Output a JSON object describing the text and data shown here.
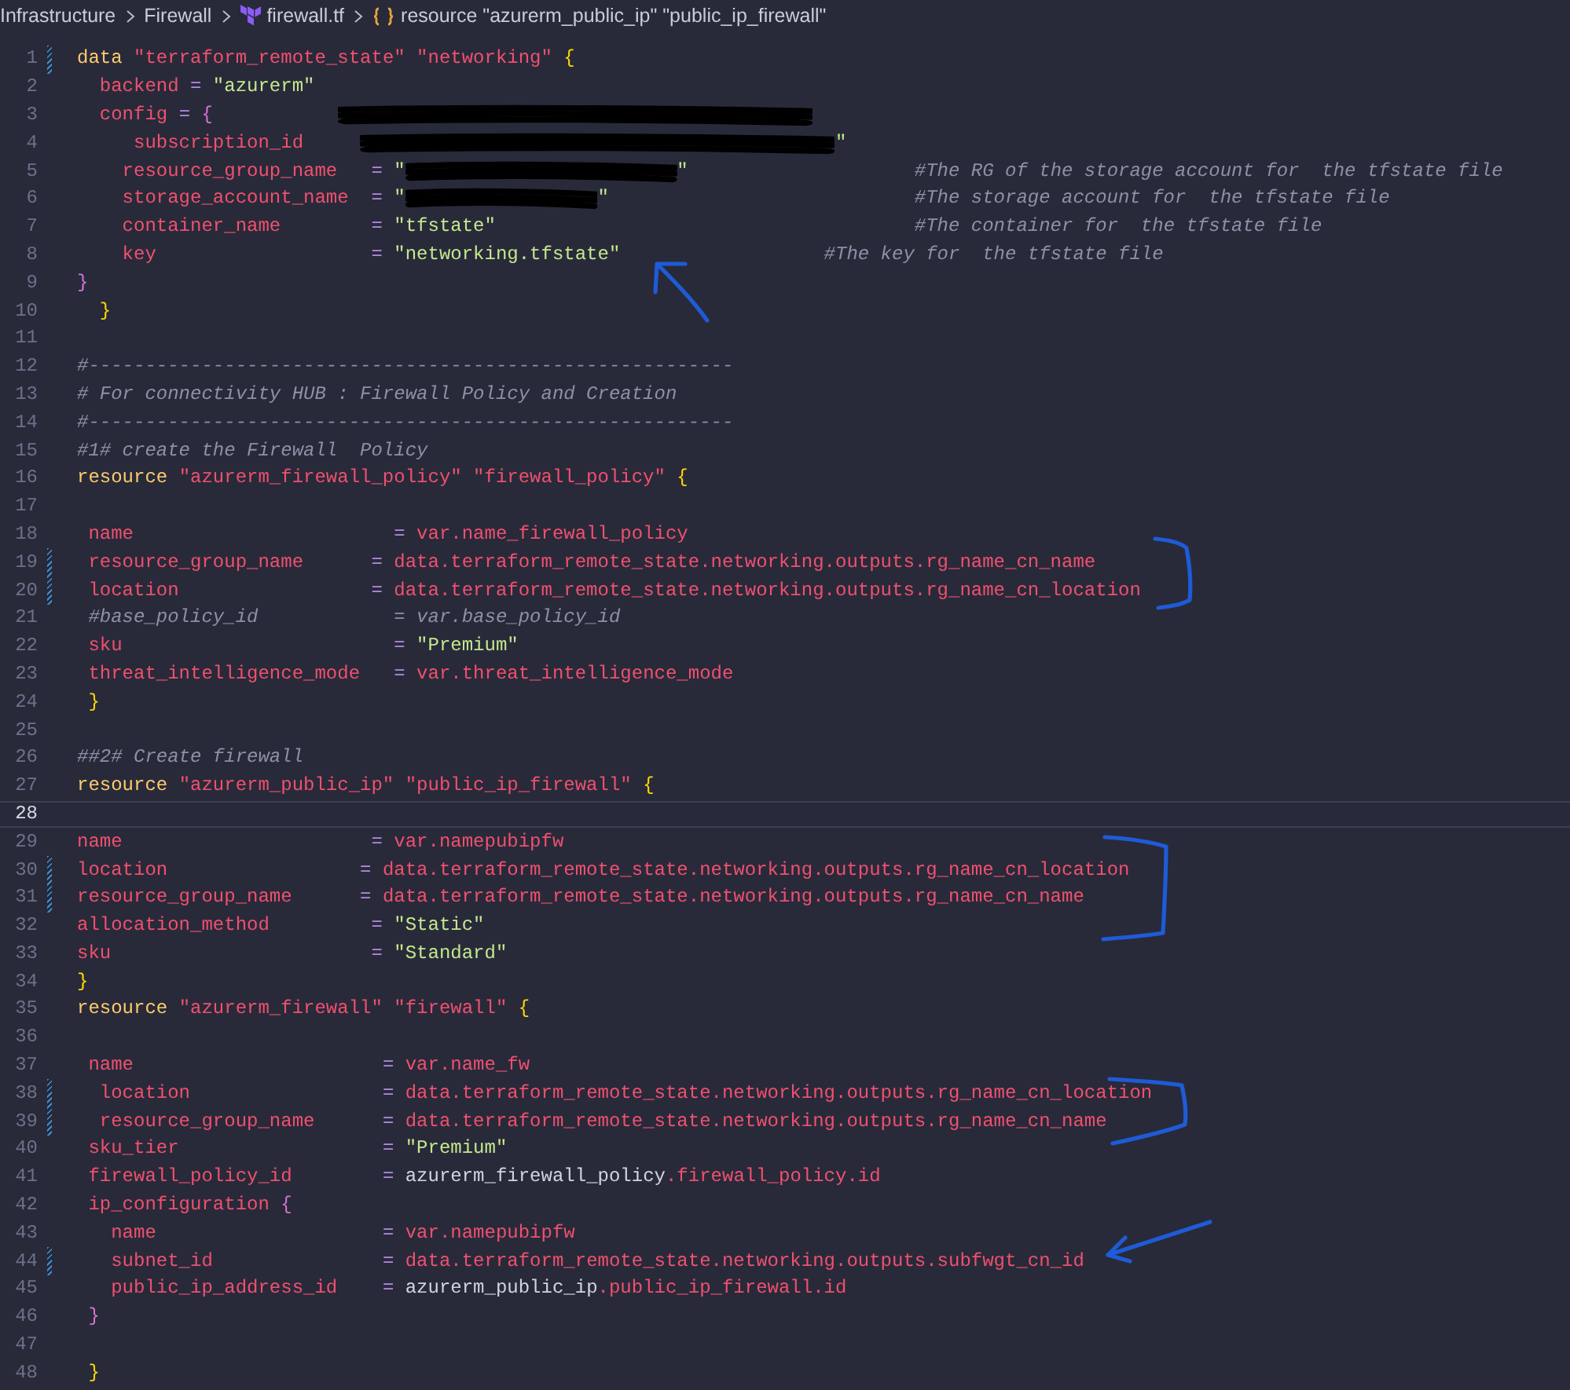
{
  "breadcrumb": [
    {
      "kind": "folder",
      "label": "Infrastructure"
    },
    {
      "kind": "folder",
      "label": "Firewall"
    },
    {
      "kind": "file",
      "label": "firewall.tf"
    },
    {
      "kind": "symbol",
      "label": "resource \"azurerm_public_ip\" \"public_ip_firewall\""
    }
  ],
  "lines": [
    {
      "number": "1",
      "modified": true,
      "current": false,
      "tokens": [
        {
          "kind": "keyword",
          "text": "data "
        },
        {
          "kind": "label",
          "text": "\"terraform_remote_state\" \"networking\" "
        },
        {
          "kind": "brace1",
          "text": "{"
        }
      ]
    },
    {
      "number": "2",
      "modified": false,
      "current": false,
      "tokens": [
        {
          "kind": "attr",
          "text": "  backend "
        },
        {
          "kind": "op",
          "text": "= "
        },
        {
          "kind": "string",
          "text": "\"azurerm\""
        }
      ]
    },
    {
      "number": "3",
      "modified": false,
      "current": false,
      "tokens": [
        {
          "kind": "attr",
          "text": "  config "
        },
        {
          "kind": "op",
          "text": "= "
        },
        {
          "kind": "brace2",
          "text": "{           "
        },
        {
          "kind": "longredaction"
        }
      ]
    },
    {
      "number": "4",
      "modified": false,
      "current": false,
      "tokens": [
        {
          "kind": "attr",
          "text": "     subscription_id     "
        },
        {
          "kind": "longredaction"
        },
        {
          "kind": "string",
          "text": "\""
        }
      ]
    },
    {
      "number": "5",
      "modified": false,
      "current": false,
      "tokens": [
        {
          "kind": "attr",
          "text": "    resource_group_name   "
        },
        {
          "kind": "op",
          "text": "= "
        },
        {
          "kind": "string",
          "text": "\""
        },
        {
          "kind": "redaction"
        },
        {
          "kind": "string",
          "text": "\""
        },
        {
          "kind": "comment",
          "text": "                    #The RG of the storage account for  the tfstate file"
        }
      ]
    },
    {
      "number": "6",
      "modified": false,
      "current": false,
      "tokens": [
        {
          "kind": "attr",
          "text": "    storage_account_name  "
        },
        {
          "kind": "op",
          "text": "= "
        },
        {
          "kind": "string",
          "text": "\""
        },
        {
          "kind": "shortredaction"
        },
        {
          "kind": "string",
          "text": "\""
        },
        {
          "kind": "comment",
          "text": "                           #The storage account for  the tfstate file"
        }
      ]
    },
    {
      "number": "7",
      "modified": false,
      "current": false,
      "tokens": [
        {
          "kind": "attr",
          "text": "    container_name        "
        },
        {
          "kind": "op",
          "text": "= "
        },
        {
          "kind": "string",
          "text": "\"tfstate\""
        },
        {
          "kind": "comment",
          "text": "                                     #The container for  the tfstate file"
        }
      ]
    },
    {
      "number": "8",
      "modified": false,
      "current": false,
      "tokens": [
        {
          "kind": "attr",
          "text": "    key                   "
        },
        {
          "kind": "op",
          "text": "= "
        },
        {
          "kind": "string",
          "text": "\"networking.tfstate\""
        },
        {
          "kind": "comment",
          "text": "                  #The key for  the tfstate file"
        }
      ]
    },
    {
      "number": "9",
      "modified": false,
      "current": false,
      "tokens": [
        {
          "kind": "brace2",
          "text": "}"
        }
      ]
    },
    {
      "number": "10",
      "modified": false,
      "current": false,
      "tokens": [
        {
          "kind": "brace1",
          "text": "  }"
        }
      ]
    },
    {
      "number": "11",
      "modified": false,
      "current": false
    },
    {
      "number": "12",
      "modified": false,
      "current": false,
      "tokens": [
        {
          "kind": "comment",
          "text": "#---------------------------------------------------------"
        }
      ]
    },
    {
      "number": "13",
      "modified": false,
      "current": false,
      "tokens": [
        {
          "kind": "comment",
          "text": "# For connectivity HUB : Firewall Policy and Creation"
        }
      ]
    },
    {
      "number": "14",
      "modified": false,
      "current": false,
      "tokens": [
        {
          "kind": "comment",
          "text": "#---------------------------------------------------------"
        }
      ]
    },
    {
      "number": "15",
      "modified": false,
      "current": false,
      "tokens": [
        {
          "kind": "comment",
          "text": "#1# create the Firewall  Policy"
        }
      ]
    },
    {
      "number": "16",
      "modified": false,
      "current": false,
      "tokens": [
        {
          "kind": "keyword",
          "text": "resource "
        },
        {
          "kind": "label",
          "text": "\"azurerm_firewall_policy\" \"firewall_policy\" "
        },
        {
          "kind": "brace1",
          "text": "{"
        }
      ]
    },
    {
      "number": "17",
      "modified": false,
      "current": false
    },
    {
      "number": "18",
      "modified": false,
      "current": false,
      "tokens": [
        {
          "kind": "attr",
          "text": " name                       "
        },
        {
          "kind": "op",
          "text": "= "
        },
        {
          "kind": "ref",
          "text": "var.name_firewall_policy"
        }
      ]
    },
    {
      "number": "19",
      "modified": true,
      "current": false,
      "tokens": [
        {
          "kind": "attr",
          "text": " resource_group_name      "
        },
        {
          "kind": "op",
          "text": "= "
        },
        {
          "kind": "ref",
          "text": "data.terraform_remote_state.networking.outputs.rg_name_cn_name"
        }
      ]
    },
    {
      "number": "20",
      "modified": true,
      "current": false,
      "tokens": [
        {
          "kind": "attr",
          "text": " location                 "
        },
        {
          "kind": "op",
          "text": "= "
        },
        {
          "kind": "ref",
          "text": "data.terraform_remote_state.networking.outputs.rg_name_cn_location"
        }
      ]
    },
    {
      "number": "21",
      "modified": false,
      "current": false,
      "tokens": [
        {
          "kind": "comment",
          "text": " #base_policy_id            = var.base_policy_id"
        }
      ]
    },
    {
      "number": "22",
      "modified": false,
      "current": false,
      "tokens": [
        {
          "kind": "attr",
          "text": " sku                        "
        },
        {
          "kind": "op",
          "text": "= "
        },
        {
          "kind": "string",
          "text": "\"Premium\""
        }
      ]
    },
    {
      "number": "23",
      "modified": false,
      "current": false,
      "tokens": [
        {
          "kind": "attr",
          "text": " threat_intelligence_mode   "
        },
        {
          "kind": "op",
          "text": "= "
        },
        {
          "kind": "ref",
          "text": "var.threat_intelligence_mode"
        }
      ]
    },
    {
      "number": "24",
      "modified": false,
      "current": false,
      "tokens": [
        {
          "kind": "brace1",
          "text": " }"
        }
      ]
    },
    {
      "number": "25",
      "modified": false,
      "current": false
    },
    {
      "number": "26",
      "modified": false,
      "current": false,
      "tokens": [
        {
          "kind": "comment",
          "text": "##2# Create firewall"
        }
      ]
    },
    {
      "number": "27",
      "modified": false,
      "current": false,
      "tokens": [
        {
          "kind": "keyword",
          "text": "resource "
        },
        {
          "kind": "label",
          "text": "\"azurerm_public_ip\" \"public_ip_firewall\" "
        },
        {
          "kind": "brace1",
          "text": "{"
        }
      ]
    },
    {
      "number": "28",
      "modified": false,
      "current": true
    },
    {
      "number": "29",
      "modified": false,
      "current": false,
      "tokens": [
        {
          "kind": "attr",
          "text": "name                      "
        },
        {
          "kind": "op",
          "text": "= "
        },
        {
          "kind": "ref",
          "text": "var.namepubipfw"
        }
      ]
    },
    {
      "number": "30",
      "modified": true,
      "current": false,
      "tokens": [
        {
          "kind": "attr",
          "text": "location                 "
        },
        {
          "kind": "op",
          "text": "= "
        },
        {
          "kind": "ref",
          "text": "data.terraform_remote_state.networking.outputs.rg_name_cn_location"
        }
      ]
    },
    {
      "number": "31",
      "modified": true,
      "current": false,
      "tokens": [
        {
          "kind": "attr",
          "text": "resource_group_name      "
        },
        {
          "kind": "op",
          "text": "= "
        },
        {
          "kind": "ref",
          "text": "data.terraform_remote_state.networking.outputs.rg_name_cn_name"
        }
      ]
    },
    {
      "number": "32",
      "modified": false,
      "current": false,
      "tokens": [
        {
          "kind": "attr",
          "text": "allocation_method         "
        },
        {
          "kind": "op",
          "text": "= "
        },
        {
          "kind": "string",
          "text": "\"Static\""
        }
      ]
    },
    {
      "number": "33",
      "modified": false,
      "current": false,
      "tokens": [
        {
          "kind": "attr",
          "text": "sku                       "
        },
        {
          "kind": "op",
          "text": "= "
        },
        {
          "kind": "string",
          "text": "\"Standard\""
        }
      ]
    },
    {
      "number": "34",
      "modified": false,
      "current": false,
      "tokens": [
        {
          "kind": "brace1",
          "text": "}"
        }
      ]
    },
    {
      "number": "35",
      "modified": false,
      "current": false,
      "tokens": [
        {
          "kind": "keyword",
          "text": "resource "
        },
        {
          "kind": "label",
          "text": "\"azurerm_firewall\" \"firewall\" "
        },
        {
          "kind": "brace1",
          "text": "{"
        }
      ]
    },
    {
      "number": "36",
      "modified": false,
      "current": false
    },
    {
      "number": "37",
      "modified": false,
      "current": false,
      "tokens": [
        {
          "kind": "attr",
          "text": " name                      "
        },
        {
          "kind": "op",
          "text": "= "
        },
        {
          "kind": "ref",
          "text": "var.name_fw"
        }
      ]
    },
    {
      "number": "38",
      "modified": true,
      "current": false,
      "tokens": [
        {
          "kind": "attr",
          "text": "  location                 "
        },
        {
          "kind": "op",
          "text": "= "
        },
        {
          "kind": "ref",
          "text": "data.terraform_remote_state.networking.outputs.rg_name_cn_location"
        }
      ]
    },
    {
      "number": "39",
      "modified": true,
      "current": false,
      "tokens": [
        {
          "kind": "attr",
          "text": "  resource_group_name      "
        },
        {
          "kind": "op",
          "text": "= "
        },
        {
          "kind": "ref",
          "text": "data.terraform_remote_state.networking.outputs.rg_name_cn_name"
        }
      ]
    },
    {
      "number": "40",
      "modified": false,
      "current": false,
      "tokens": [
        {
          "kind": "attr",
          "text": " sku_tier                  "
        },
        {
          "kind": "op",
          "text": "= "
        },
        {
          "kind": "string",
          "text": "\"Premium\""
        }
      ]
    },
    {
      "number": "41",
      "modified": false,
      "current": false,
      "tokens": [
        {
          "kind": "attr",
          "text": " firewall_policy_id        "
        },
        {
          "kind": "op",
          "text": "= "
        },
        {
          "kind": "plain",
          "text": "azurerm_firewall_policy"
        },
        {
          "kind": "ref",
          "text": ".firewall_policy.id"
        }
      ]
    },
    {
      "number": "42",
      "modified": false,
      "current": false,
      "tokens": [
        {
          "kind": "attr",
          "text": " ip_configuration "
        },
        {
          "kind": "brace2",
          "text": "{"
        }
      ]
    },
    {
      "number": "43",
      "modified": false,
      "current": false,
      "tokens": [
        {
          "kind": "attr",
          "text": "   name                    "
        },
        {
          "kind": "op",
          "text": "= "
        },
        {
          "kind": "ref",
          "text": "var.namepubipfw"
        }
      ]
    },
    {
      "number": "44",
      "modified": true,
      "current": false,
      "tokens": [
        {
          "kind": "attr",
          "text": "   subnet_id               "
        },
        {
          "kind": "op",
          "text": "= "
        },
        {
          "kind": "ref",
          "text": "data.terraform_remote_state.networking.outputs.subfwgt_cn_id"
        }
      ]
    },
    {
      "number": "45",
      "modified": false,
      "current": false,
      "tokens": [
        {
          "kind": "attr",
          "text": "   public_ip_address_id    "
        },
        {
          "kind": "op",
          "text": "= "
        },
        {
          "kind": "plain",
          "text": "azurerm_public_ip"
        },
        {
          "kind": "ref",
          "text": ".public_ip_firewall.id"
        }
      ]
    },
    {
      "number": "46",
      "modified": false,
      "current": false,
      "tokens": [
        {
          "kind": "brace2",
          "text": " }"
        }
      ]
    },
    {
      "number": "47",
      "modified": false,
      "current": false
    },
    {
      "number": "48",
      "modified": false,
      "current": false,
      "tokens": [
        {
          "kind": "brace1",
          "text": " }"
        }
      ]
    }
  ],
  "annotations": [
    {
      "kind": "arrow"
    },
    {
      "kind": "bracket"
    },
    {
      "kind": "bracket"
    },
    {
      "kind": "bracket"
    },
    {
      "kind": "arrow"
    }
  ]
}
